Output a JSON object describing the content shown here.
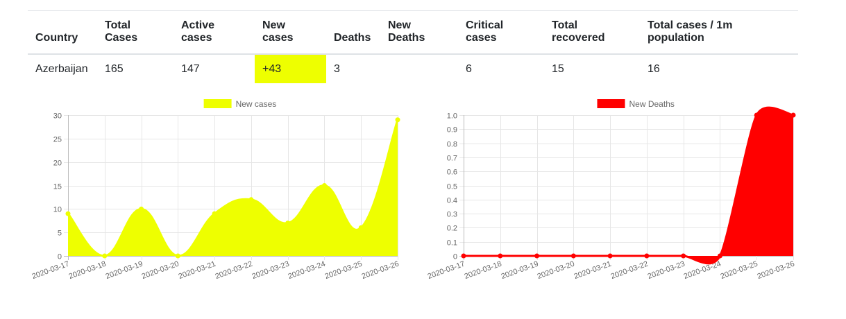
{
  "table": {
    "headers": [
      "Country",
      "Total\nCases",
      "Active\ncases",
      "New\ncases",
      "Deaths",
      "New\nDeaths",
      "Critical\ncases",
      "Total\nrecovered",
      "Total cases / 1m\npopulation"
    ],
    "row": [
      "Azerbaijan",
      "165",
      "147",
      "+43",
      "3",
      "",
      "6",
      "15",
      "16"
    ],
    "highlight_color": "#eeff00"
  },
  "chart_data": [
    {
      "type": "area",
      "series": [
        {
          "name": "New cases",
          "values": [
            9,
            0,
            10,
            0,
            9,
            12,
            7,
            15,
            6,
            29
          ],
          "color": "#eeff00"
        }
      ],
      "categories": [
        "2020-03-17",
        "2020-03-18",
        "2020-03-19",
        "2020-03-20",
        "2020-03-21",
        "2020-03-22",
        "2020-03-23",
        "2020-03-24",
        "2020-03-25",
        "2020-03-26"
      ],
      "ylim": [
        0,
        30
      ],
      "yticks": [
        "0",
        "5",
        "10",
        "15",
        "20",
        "25",
        "30"
      ],
      "legend": "top",
      "grid": true
    },
    {
      "type": "area",
      "series": [
        {
          "name": "New Deaths",
          "values": [
            0,
            0,
            0,
            0,
            0,
            0,
            0,
            0,
            1,
            1
          ],
          "color": "#ff0000"
        }
      ],
      "categories": [
        "2020-03-17",
        "2020-03-18",
        "2020-03-19",
        "2020-03-20",
        "2020-03-21",
        "2020-03-22",
        "2020-03-23",
        "2020-03-24",
        "2020-03-25",
        "2020-03-26"
      ],
      "ylim": [
        0,
        1
      ],
      "yticks": [
        "0",
        "0.1",
        "0.2",
        "0.3",
        "0.4",
        "0.5",
        "0.6",
        "0.7",
        "0.8",
        "0.9",
        "1.0"
      ],
      "legend": "top",
      "grid": true
    }
  ]
}
